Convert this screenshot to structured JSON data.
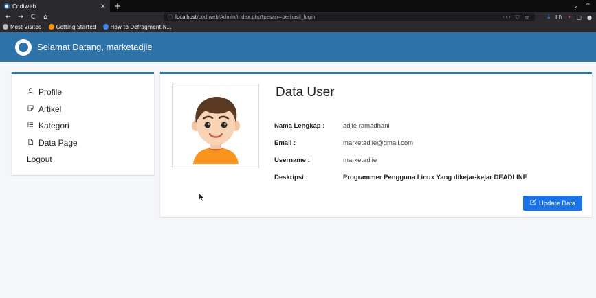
{
  "browser": {
    "tab_title": "Codiweb",
    "tab_close": "×",
    "new_tab": "+",
    "window_controls": [
      "⌄",
      "^"
    ],
    "url_info": "ⓘ",
    "url_host": "localhost",
    "url_path": "/codiweb/Admin/index.php?pesan=berhasil_login",
    "url_actions": "··· ♡ ☆",
    "nav": {
      "back": "←",
      "forward": "→",
      "reload": "C",
      "home": "⌂"
    },
    "toolbar_icons": [
      "⤓",
      "III\\",
      "•",
      "▢",
      "●"
    ],
    "bookmarks": [
      {
        "label": "Most Visited",
        "icon": "gear-icon",
        "color": "#bbbbbb"
      },
      {
        "label": "Getting Started",
        "icon": "firefox-icon",
        "color": "#ff9500"
      },
      {
        "label": "How to Defragment N...",
        "icon": "google-icon",
        "color": "#4285f4"
      }
    ]
  },
  "header": {
    "title": "Selamat Datang, marketadjie",
    "brand_color": "#2d72a9"
  },
  "sidebar": {
    "items": [
      {
        "label": "Profile",
        "icon": "user-icon"
      },
      {
        "label": "Artikel",
        "icon": "note-icon"
      },
      {
        "label": "Kategori",
        "icon": "list-icon"
      },
      {
        "label": "Data Page",
        "icon": "file-icon"
      },
      {
        "label": "Logout",
        "icon": ""
      }
    ]
  },
  "card": {
    "title": "Data User",
    "fields": [
      {
        "label": "Nama Lengkap :",
        "value": "adjie ramadhani"
      },
      {
        "label": "Email :",
        "value": "marketadjie@gmail.com"
      },
      {
        "label": "Username :",
        "value": "marketadjie"
      },
      {
        "label": "Deskripsi :",
        "value": "Programmer Pengguna Linux Yang dikejar-kejar DEADLINE"
      }
    ],
    "update_button": "Update Data",
    "button_color": "#1a73e8"
  }
}
